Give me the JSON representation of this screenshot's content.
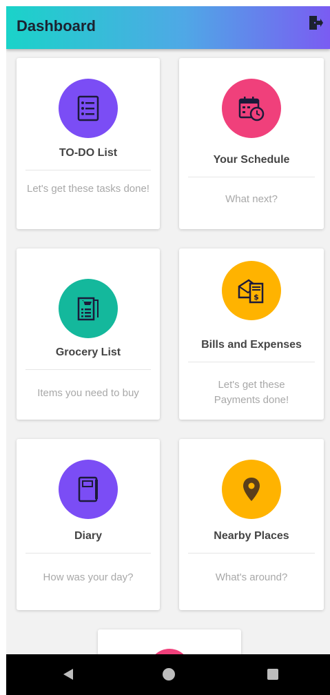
{
  "header": {
    "title": "Dashboard",
    "logout_icon": "logout-door-icon"
  },
  "colors": {
    "purple": "#7b4df5",
    "pink": "#f0407b",
    "teal": "#14b89c",
    "amber": "#ffb300"
  },
  "cards": [
    {
      "title": "TO-DO List",
      "subtitle": "Let's get these tasks done!",
      "icon": "checklist-icon"
    },
    {
      "title": "Your Schedule",
      "subtitle": "What next?",
      "icon": "calendar-clock-icon"
    },
    {
      "title": "Grocery List",
      "subtitle": "Items you need to buy",
      "icon": "shopping-cart-list-icon"
    },
    {
      "title": "Bills and Expenses",
      "subtitle": "Let's get these Payments done!",
      "icon": "bill-envelope-icon"
    },
    {
      "title": "Diary",
      "subtitle": "How was your day?",
      "icon": "notebook-icon"
    },
    {
      "title": "Nearby Places",
      "subtitle": "What's around?",
      "icon": "map-pin-icon"
    }
  ],
  "navbar": {
    "back": "back-triangle-icon",
    "home": "home-circle-icon",
    "recents": "recents-square-icon"
  }
}
